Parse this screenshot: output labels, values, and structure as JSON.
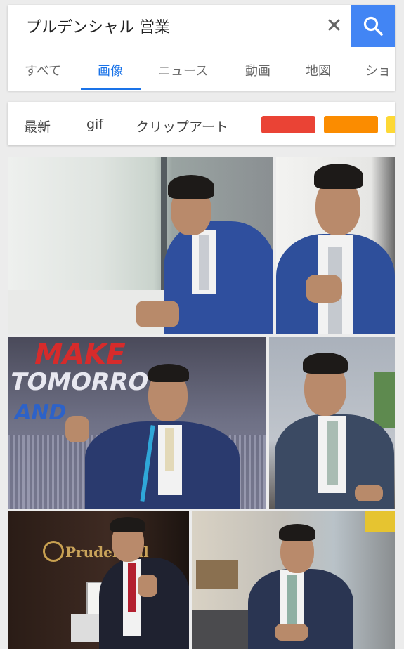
{
  "search": {
    "query": "プルデンシャル 営業",
    "clear_icon": "close-icon",
    "search_icon": "search-icon",
    "accent_color": "#4285f4"
  },
  "tabs": [
    {
      "label": "すべて",
      "active": false
    },
    {
      "label": "画像",
      "active": true
    },
    {
      "label": "ニュース",
      "active": false
    },
    {
      "label": "動画",
      "active": false
    },
    {
      "label": "地図",
      "active": false
    },
    {
      "label": "ショ",
      "active": false
    }
  ],
  "filters": {
    "chips": [
      "最新",
      "gif",
      "クリップアート"
    ],
    "color_swatches": [
      "#ea4335",
      "#fb8c00",
      "#fdd835"
    ]
  },
  "images": [
    {
      "subject": "man in blue suit leaning by window"
    },
    {
      "subject": "man in blue suit adjusting tie"
    },
    {
      "subject": "man in pinstripe suit with lanyard fist raised",
      "sign_text_1": "MAKE",
      "sign_text_2": "TOMORROW,",
      "sign_text_3": "AND"
    },
    {
      "subject": "man in navy suit seated"
    },
    {
      "subject": "man in dark suit in office lobby",
      "sign_text": "Prudential"
    },
    {
      "subject": "man in navy suit seated at office desk"
    }
  ]
}
